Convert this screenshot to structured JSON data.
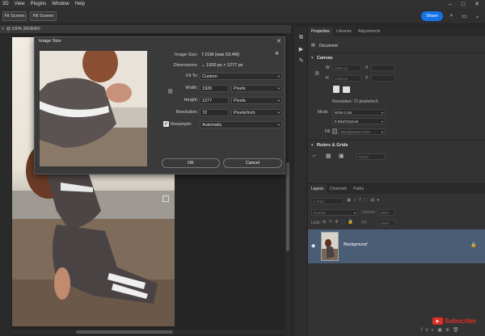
{
  "menu": [
    "3D",
    "View",
    "Plugins",
    "Window",
    "Help"
  ],
  "options_bar": {
    "fit_screen": "Fit Screen",
    "fill_screen": "Fill Screen",
    "share": "Share"
  },
  "document_tab": {
    "title": "@ 100% (RGB/8#)"
  },
  "properties_panel": {
    "tabs": [
      "Properties",
      "Libraries",
      "Adjustments"
    ],
    "doc_label": "Document",
    "canvas_title": "Canvas",
    "w_field": "1920 px",
    "h_field": "1280 px",
    "x_label": "X",
    "y_label": "Y",
    "resolution": "Resolution: 72 pixels/inch",
    "mode_label": "Mode",
    "mode_value": "RGB Color",
    "bits_value": "8 Bits/Channel",
    "fill_label": "Fill",
    "fill_value": "Background Color",
    "rulers_title": "Rulers & Grids",
    "pixels_unit": "Pixels"
  },
  "layers_panel": {
    "tabs": [
      "Layers",
      "Channels",
      "Paths"
    ],
    "kind_placeholder": "Kind",
    "blend_mode": "Normal",
    "opacity_label": "Opacity:",
    "opacity_value": "100%",
    "lock_label": "Lock:",
    "fill_label": "Fill:",
    "fill_value": "100%",
    "layer_name": "Background"
  },
  "dialog": {
    "title": "Image Size",
    "image_size_label": "Image Size:",
    "image_size_value": "7.01M (was 53.4M)",
    "dimensions_label": "Dimensions:",
    "dimensions_value": "1920 px  ×  1277 px",
    "fit_to_label": "Fit To:",
    "fit_to_value": "Custom",
    "width_label": "Width:",
    "width_value": "1920",
    "width_unit": "Pixels",
    "height_label": "Height:",
    "height_value": "1277",
    "height_unit": "Pixels",
    "resolution_label": "Resolution:",
    "resolution_value": "72",
    "resolution_unit": "Pixels/Inch",
    "resample_label": "Resample:",
    "resample_value": "Automatic",
    "ok": "OK",
    "cancel": "Cancel"
  },
  "subscribe": {
    "label": "Subscribe"
  },
  "colors": {
    "accent": "#1473e6",
    "layer_selected": "#4a5d75",
    "youtube": "#e52d27"
  }
}
